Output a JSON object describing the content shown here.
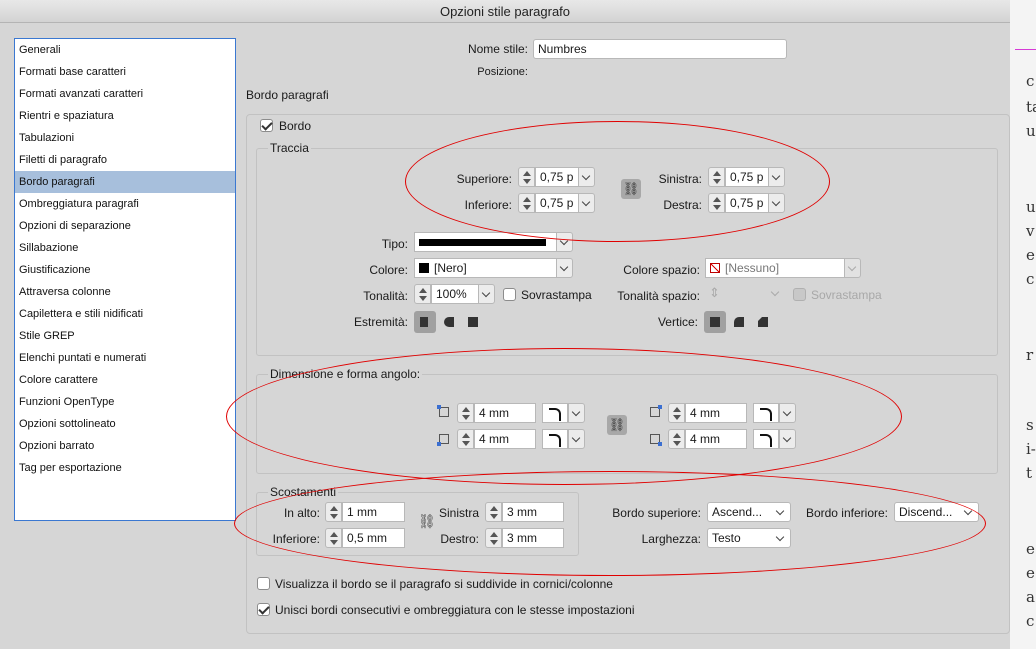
{
  "window": {
    "title": "Opzioni stile paragrafo"
  },
  "sidebar": {
    "items": [
      "Generali",
      "Formati base caratteri",
      "Formati avanzati caratteri",
      "Rientri e spaziatura",
      "Tabulazioni",
      "Filetti di paragrafo",
      "Bordo paragrafi",
      "Ombreggiatura paragrafi",
      "Opzioni di separazione",
      "Sillabazione",
      "Giustificazione",
      "Attraversa colonne",
      "Capilettera e stili nidificati",
      "Stile GREP",
      "Elenchi puntati e numerati",
      "Colore carattere",
      "Funzioni OpenType",
      "Opzioni sottolineato",
      "Opzioni barrato",
      "Tag per esportazione"
    ],
    "selected": "Bordo paragrafi"
  },
  "header": {
    "style_name_label": "Nome stile:",
    "style_name_value": "Numbres",
    "position_label": "Posizione:",
    "section_title": "Bordo paragrafi"
  },
  "border": {
    "checkbox_label": "Bordo",
    "checked": true
  },
  "stroke": {
    "title": "Traccia",
    "top_label": "Superiore:",
    "top_value": "0,75 p",
    "bottom_label": "Inferiore:",
    "bottom_value": "0,75 p",
    "left_label": "Sinistra:",
    "left_value": "0,75 p",
    "right_label": "Destra:",
    "right_value": "0,75 p",
    "type_label": "Tipo:",
    "color_label": "Colore:",
    "color_value": "[Nero]",
    "gap_color_label": "Colore spazio:",
    "gap_color_value": "[Nessuno]",
    "tint_label": "Tonalità:",
    "tint_value": "100%",
    "overprint_label": "Sovrastampa",
    "gap_tint_label": "Tonalità spazio:",
    "gap_overprint_label": "Sovrastampa",
    "cap_label": "Estremità:",
    "join_label": "Vertice:"
  },
  "corners": {
    "title": "Dimensione e forma angolo:",
    "top_left": "4 mm",
    "bottom_left": "4 mm",
    "top_right": "4 mm",
    "bottom_right": "4 mm"
  },
  "offsets": {
    "title": "Scostamenti",
    "top_label": "In alto:",
    "top_value": "1 mm",
    "bottom_label": "Inferiore:",
    "bottom_value": "0,5 mm",
    "left_label": "Sinistra",
    "left_value": "3 mm",
    "right_label": "Destro:",
    "right_value": "3 mm",
    "top_edge_label": "Bordo superiore:",
    "top_edge_value": "Ascend...",
    "bottom_edge_label": "Bordo inferiore:",
    "bottom_edge_value": "Discend...",
    "width_label": "Larghezza:",
    "width_value": "Testo"
  },
  "options": {
    "split_label": "Visualizza il bordo se il paragrafo si suddivide in cornici/colonne",
    "split_checked": false,
    "merge_label": "Unisci bordi consecutivi e ombreggiatura con le stesse impostazioni",
    "merge_checked": true
  },
  "colors": {
    "annotation": "#e00000",
    "selection": "#a7bfdc",
    "sidebar_border": "#3b78d1"
  }
}
